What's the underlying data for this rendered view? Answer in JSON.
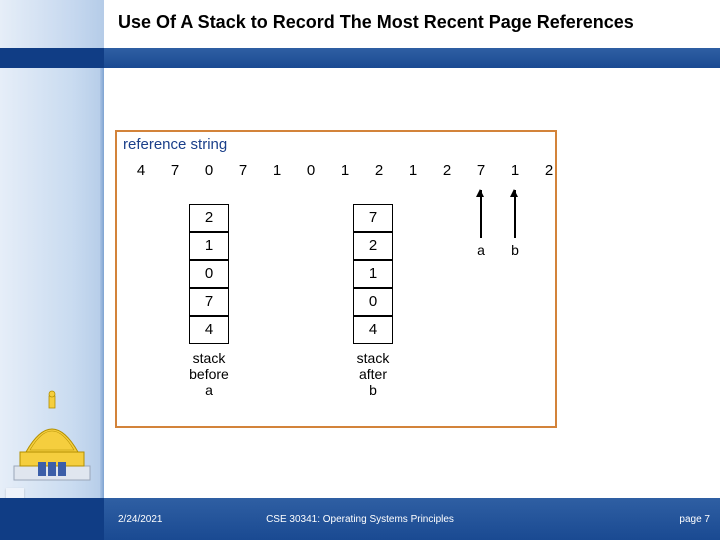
{
  "header": {
    "title": "Use Of A Stack to Record The Most Recent Page References"
  },
  "figure": {
    "reference_label": "reference string",
    "reference_string": [
      "4",
      "7",
      "0",
      "7",
      "1",
      "0",
      "1",
      "2",
      "1",
      "2",
      "7",
      "1",
      "2"
    ],
    "stack_before": {
      "values": [
        "2",
        "1",
        "0",
        "7",
        "4"
      ],
      "caption_line1": "stack",
      "caption_line2": "before",
      "caption_line3": "a"
    },
    "stack_after": {
      "values": [
        "7",
        "2",
        "1",
        "0",
        "4"
      ],
      "caption_line1": "stack",
      "caption_line2": "after",
      "caption_line3": "b"
    },
    "arrow_a": "a",
    "arrow_b": "b"
  },
  "footer": {
    "date": "2/24/2021",
    "center": "CSE 30341: Operating Systems Principles",
    "page": "page 7"
  },
  "colors": {
    "accent_border": "#d3833a",
    "brand_blue": "#1a4a92"
  }
}
